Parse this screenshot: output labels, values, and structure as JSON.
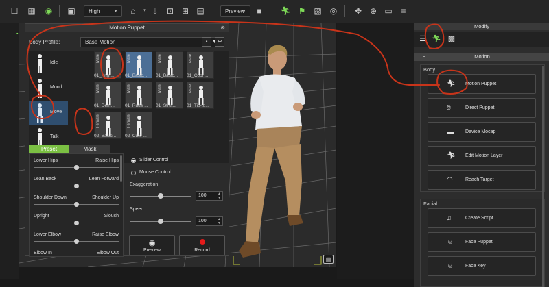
{
  "toolbar": {
    "quality": "High",
    "view_mode": "Preview"
  },
  "motion_puppet": {
    "title": "Motion Puppet",
    "body_profile_label": "Body Profile:",
    "body_profile_value": "Base Motion",
    "categories": [
      {
        "label": "Idle"
      },
      {
        "label": "Mood"
      },
      {
        "label": "Move"
      },
      {
        "label": "Talk"
      }
    ],
    "thumbnails": [
      {
        "side": "Male",
        "label": "01_Angr..."
      },
      {
        "side": "Male",
        "label": "01_Basic..."
      },
      {
        "side": "Male",
        "label": "01_Basic..."
      },
      {
        "side": "Male",
        "label": "01_Cool ..."
      },
      {
        "side": "Male",
        "label": "01_Dem..."
      },
      {
        "side": "Male",
        "label": "01_Rude ..."
      },
      {
        "side": "Male",
        "label": "01_Strut..."
      },
      {
        "side": "Male",
        "label": "01_Tip-to..."
      },
      {
        "side": "Female",
        "label": "02_Basic..."
      },
      {
        "side": "Female",
        "label": "02_Cute ..."
      }
    ],
    "tabs": {
      "preset": "Preset",
      "mask": "Mask"
    },
    "sliders": [
      {
        "left": "Lower Hips",
        "right": "Raise Hips",
        "value": 0.5
      },
      {
        "left": "Lean Back",
        "right": "Lean Forward",
        "value": 0.5
      },
      {
        "left": "Shoulder Down",
        "right": "Shoulder Up",
        "value": 0.5
      },
      {
        "left": "Upright",
        "right": "Slouch",
        "value": 0.5
      },
      {
        "left": "Lower Elbow",
        "right": "Raise Elbow",
        "value": 0.5
      },
      {
        "left": "Elbow In",
        "right": "Elbow Out",
        "value": 0.5
      }
    ],
    "slider_control": "Slider Control",
    "mouse_control": "Mouse Control",
    "exaggeration_label": "Exaggeration",
    "exaggeration_value": "100",
    "speed_label": "Speed",
    "speed_value": "100",
    "preview_label": "Preview",
    "record_label": "Record"
  },
  "modify": {
    "title": "Modify",
    "section": "Motion",
    "body_group": "Body",
    "body_buttons": [
      {
        "label": "Motion Puppet",
        "icon": "motion-puppet-icon"
      },
      {
        "label": "Direct Puppet",
        "icon": "direct-puppet-icon"
      },
      {
        "label": "Device Mocap",
        "icon": "device-mocap-icon"
      },
      {
        "label": "Edit Motion Layer",
        "icon": "edit-motion-layer-icon"
      },
      {
        "label": "Reach Target",
        "icon": "reach-target-icon"
      }
    ],
    "facial_group": "Facial",
    "facial_buttons": [
      {
        "label": "Create Script",
        "icon": "create-script-icon"
      },
      {
        "label": "Face Puppet",
        "icon": "face-puppet-icon"
      },
      {
        "label": "Face Key",
        "icon": "face-key-icon"
      }
    ]
  },
  "colors": {
    "accent_green": "#7bc043",
    "selection_blue": "#4c6f96",
    "annotation_red": "#c8341a",
    "record_red": "#e41b1b"
  }
}
